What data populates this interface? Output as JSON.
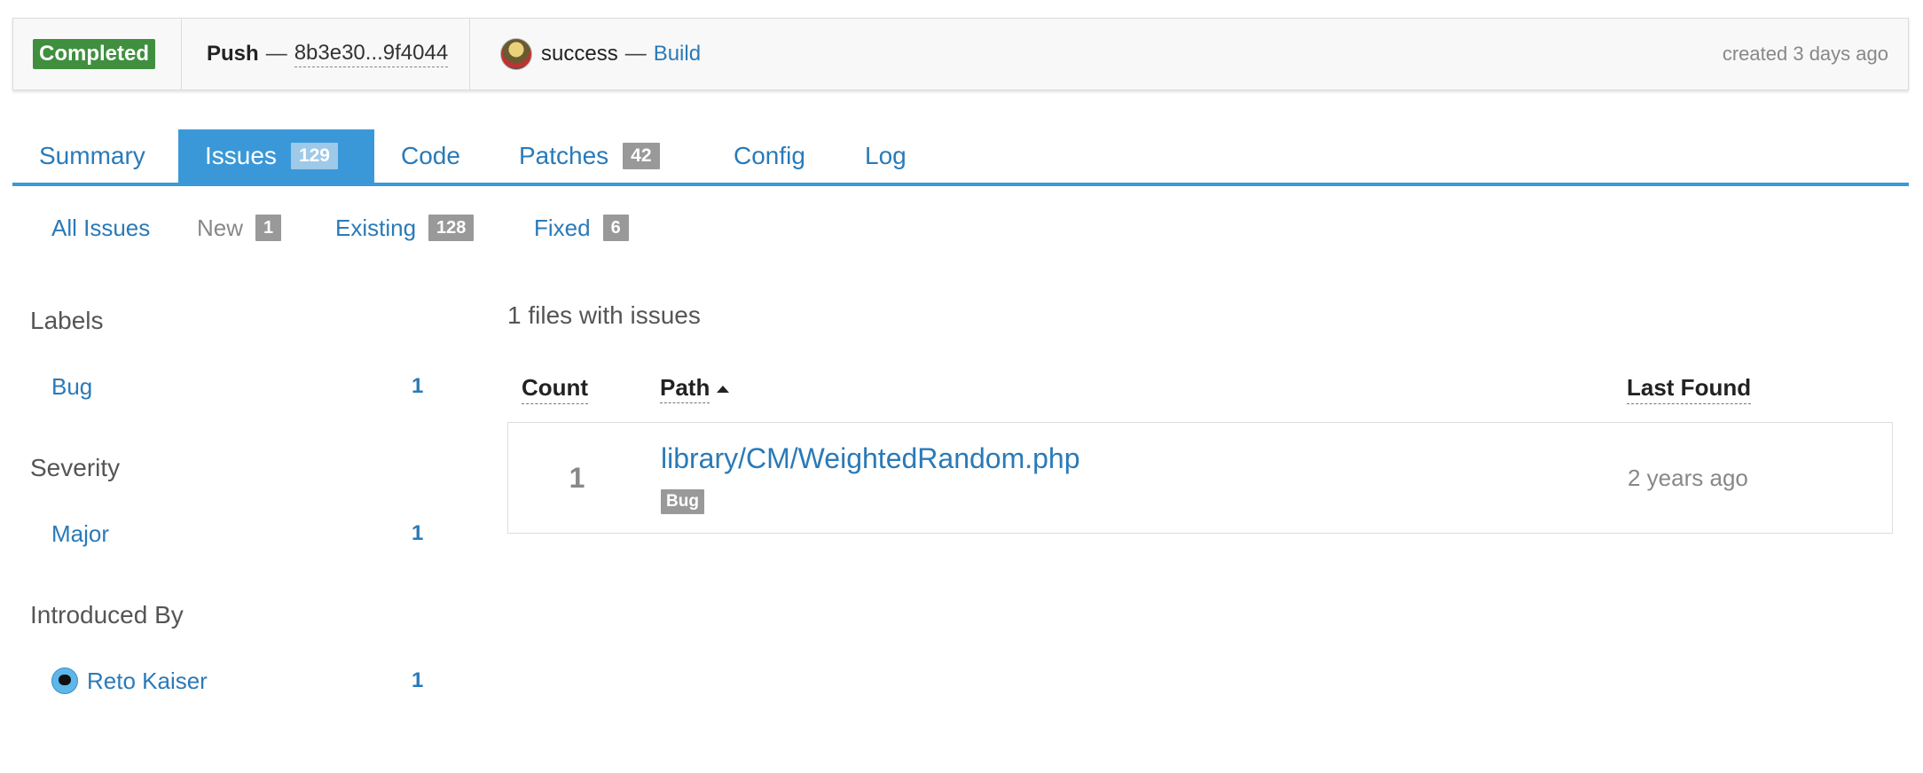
{
  "header": {
    "status": "Completed",
    "push_label": "Push",
    "separator": "—",
    "commit_range": "8b3e30...9f4044",
    "build_status": "success",
    "build_link": "Build",
    "created": "created 3 days ago",
    "status_color": "#3f8f3f"
  },
  "tabs": [
    {
      "label": "Summary"
    },
    {
      "label": "Issues",
      "count": "129",
      "active": true
    },
    {
      "label": "Code"
    },
    {
      "label": "Patches",
      "count": "42"
    },
    {
      "label": "Config"
    },
    {
      "label": "Log"
    }
  ],
  "filters": [
    {
      "label": "All Issues"
    },
    {
      "label": "New",
      "count": "1"
    },
    {
      "label": "Existing",
      "count": "128"
    },
    {
      "label": "Fixed",
      "count": "6"
    }
  ],
  "sidebar": {
    "labels_heading": "Labels",
    "labels": [
      {
        "label": "Bug",
        "count": "1"
      }
    ],
    "severity_heading": "Severity",
    "severity": [
      {
        "label": "Major",
        "count": "1"
      }
    ],
    "introduced_heading": "Introduced By",
    "introduced": [
      {
        "label": "Reto Kaiser",
        "count": "1"
      }
    ]
  },
  "main": {
    "files_summary": "1 files with issues",
    "columns": {
      "count": "Count",
      "path": "Path",
      "last_found": "Last Found"
    },
    "rows": [
      {
        "count": "1",
        "path": "library/CM/WeightedRandom.php",
        "label": "Bug",
        "last_found": "2 years ago"
      }
    ]
  },
  "colors": {
    "accent": "#3a98d8",
    "link": "#2a7ab8",
    "badge": "#999999"
  }
}
